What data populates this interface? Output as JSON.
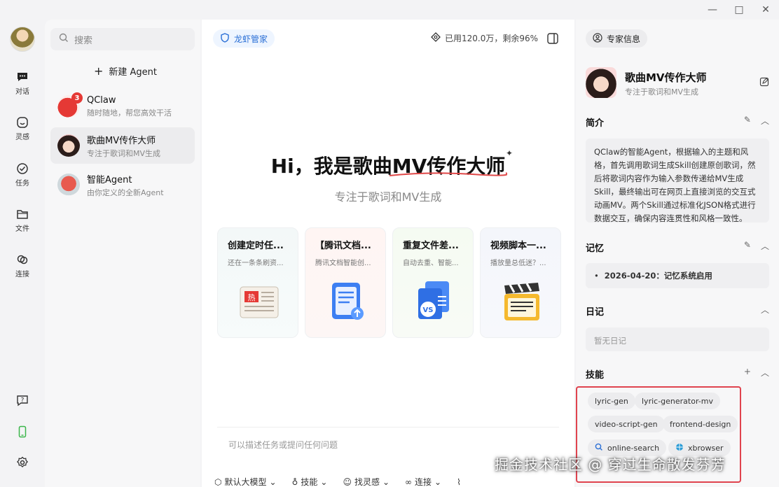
{
  "rail": {
    "items": [
      {
        "label": "对话"
      },
      {
        "label": "灵感"
      },
      {
        "label": "任务"
      },
      {
        "label": "文件"
      },
      {
        "label": "连接"
      }
    ]
  },
  "list": {
    "search_placeholder": "搜索",
    "new_agent_label": "新建 Agent",
    "agents": [
      {
        "name": "QClaw",
        "desc": "随时随地，帮您高效干活",
        "badge": "3"
      },
      {
        "name": "歌曲MV传作大师",
        "desc": "专注于歌词和MV生成"
      },
      {
        "name": "智能Agent",
        "desc": "由你定义的全新Agent"
      }
    ]
  },
  "main": {
    "brand": "龙虾管家",
    "usage": "已用120.0万，剩余96%",
    "hero_title": "Hi，我是歌曲MV传作大师",
    "hero_sub": "专注于歌词和MV生成",
    "cards": [
      {
        "title": "创建定时任...",
        "desc": "还在一条条刷资..."
      },
      {
        "title": "【腾讯文档...",
        "desc": "腾讯文档智能创..."
      },
      {
        "title": "重复文件差...",
        "desc": "自动去重、智能..."
      },
      {
        "title": "视频脚本一...",
        "desc": "播放量总低迷？..."
      }
    ],
    "composer_placeholder": "可以描述任务或提问任何问题",
    "composer_opts": [
      "默认大模型",
      "技能",
      "找灵感",
      "连接"
    ]
  },
  "right": {
    "pill": "专家信息",
    "expert_name": "歌曲MV传作大师",
    "expert_sub": "专注于歌词和MV生成",
    "intro_title": "简介",
    "intro_text": "QClaw的智能Agent，根据输入的主题和风格，首先调用歌词生成Skill创建原创歌词，然后将歌词内容作为输入参数传递给MV生成Skill，最终输出可在网页上直接浏览的交互式动画MV。两个Skill通过标准化JSON格式进行数据交互，确保内容连贯性和风格一致性。",
    "memory_title": "记忆",
    "memory_item": "2026-04-20：记忆系统启用",
    "diary_title": "日记",
    "diary_empty": "暂无日记",
    "skills_title": "技能",
    "skills": [
      "lyric-gen",
      "lyric-generator-mv",
      "video-script-gen",
      "frontend-design",
      "online-search",
      "xbrowser"
    ]
  },
  "watermark": "掘金技术社区 @ 穿过生命散发芬芳"
}
